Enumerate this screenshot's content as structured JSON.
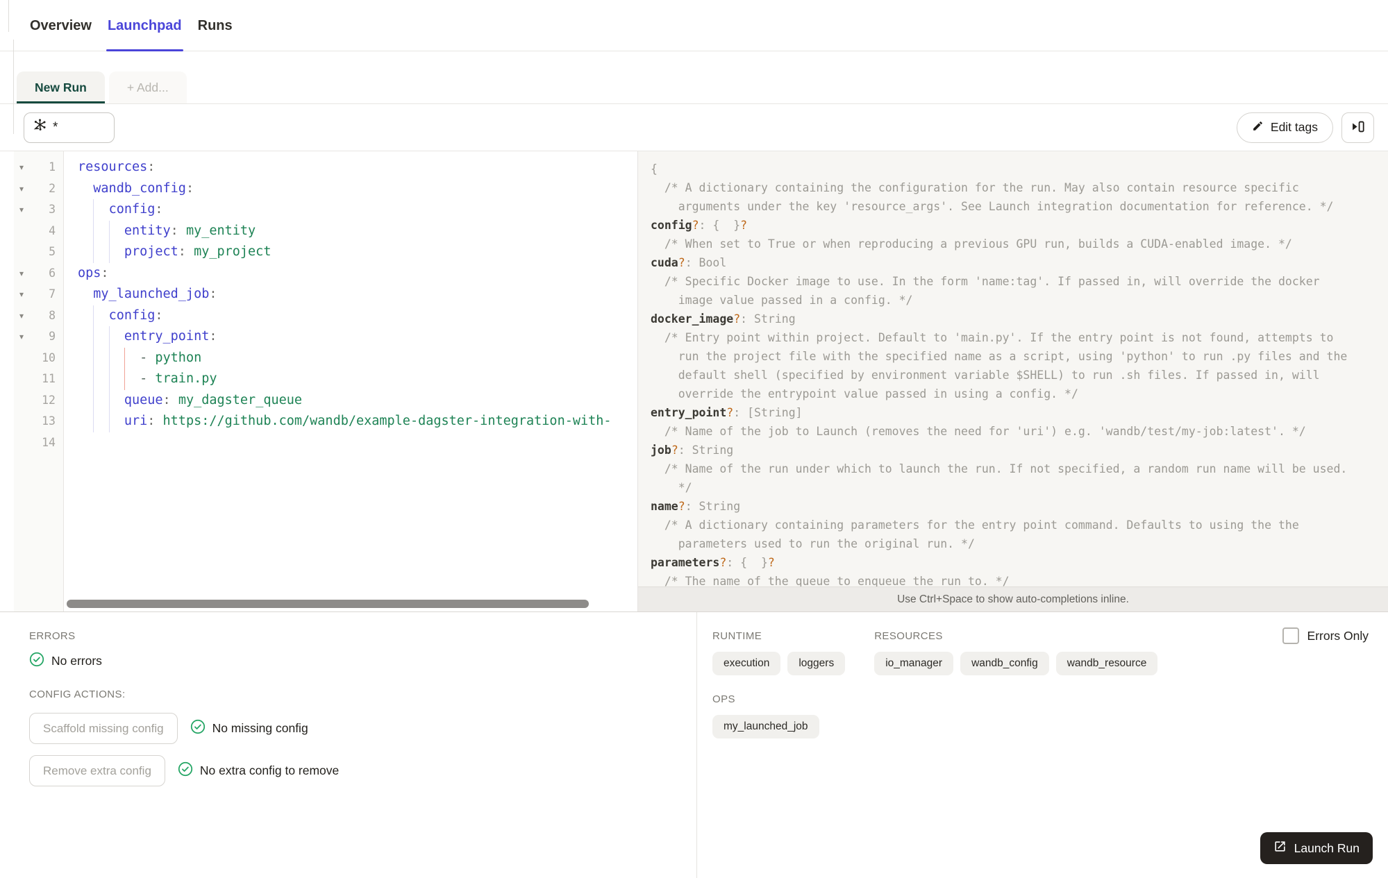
{
  "header": {
    "tabs": [
      {
        "label": "Overview",
        "active": false
      },
      {
        "label": "Launchpad",
        "active": true
      },
      {
        "label": "Runs",
        "active": false
      }
    ]
  },
  "session": {
    "tabs": [
      {
        "label": "New Run",
        "active": true
      },
      {
        "label": "+ Add...",
        "active": false
      }
    ]
  },
  "toolbar": {
    "op_selector_value": "*",
    "op_selector_icon": "op-selector-icon",
    "edit_tags": "Edit tags",
    "expand_icon": "open-in-panel-icon"
  },
  "editor": {
    "yaml_lines": [
      {
        "n": "1",
        "fold": true,
        "guides": [],
        "tokens": [
          [
            "k",
            "resources"
          ],
          [
            "p",
            ":"
          ]
        ]
      },
      {
        "n": "2",
        "fold": true,
        "guides": [],
        "tokens": [
          [
            "w",
            "  "
          ],
          [
            "k",
            "wandb_config"
          ],
          [
            "p",
            ":"
          ]
        ]
      },
      {
        "n": "3",
        "fold": true,
        "guides": [
          2
        ],
        "tokens": [
          [
            "w",
            "    "
          ],
          [
            "k",
            "config"
          ],
          [
            "p",
            ":"
          ]
        ]
      },
      {
        "n": "4",
        "fold": false,
        "guides": [
          2,
          4
        ],
        "tokens": [
          [
            "w",
            "      "
          ],
          [
            "k",
            "entity"
          ],
          [
            "p",
            ":"
          ],
          [
            "w",
            " "
          ],
          [
            "v",
            "my_entity"
          ]
        ]
      },
      {
        "n": "5",
        "fold": false,
        "guides": [
          2,
          4
        ],
        "tokens": [
          [
            "w",
            "      "
          ],
          [
            "k",
            "project"
          ],
          [
            "p",
            ":"
          ],
          [
            "w",
            " "
          ],
          [
            "v",
            "my_project"
          ]
        ]
      },
      {
        "n": "6",
        "fold": true,
        "guides": [],
        "tokens": [
          [
            "k",
            "ops"
          ],
          [
            "p",
            ":"
          ]
        ]
      },
      {
        "n": "7",
        "fold": true,
        "guides": [],
        "tokens": [
          [
            "w",
            "  "
          ],
          [
            "k",
            "my_launched_job"
          ],
          [
            "p",
            ":"
          ]
        ]
      },
      {
        "n": "8",
        "fold": true,
        "guides": [
          2
        ],
        "tokens": [
          [
            "w",
            "    "
          ],
          [
            "k",
            "config"
          ],
          [
            "p",
            ":"
          ]
        ]
      },
      {
        "n": "9",
        "fold": true,
        "guides": [
          2,
          4
        ],
        "tokens": [
          [
            "w",
            "      "
          ],
          [
            "k",
            "entry_point"
          ],
          [
            "p",
            ":"
          ]
        ]
      },
      {
        "n": "10",
        "fold": false,
        "guides": [
          2,
          4
        ],
        "active_guide": 6,
        "tokens": [
          [
            "w",
            "        "
          ],
          [
            "d",
            "-"
          ],
          [
            "w",
            " "
          ],
          [
            "v",
            "python"
          ]
        ]
      },
      {
        "n": "11",
        "fold": false,
        "guides": [
          2,
          4
        ],
        "active_guide": 6,
        "tokens": [
          [
            "w",
            "        "
          ],
          [
            "d",
            "-"
          ],
          [
            "w",
            " "
          ],
          [
            "v",
            "train.py"
          ]
        ]
      },
      {
        "n": "12",
        "fold": false,
        "guides": [
          2,
          4
        ],
        "tokens": [
          [
            "w",
            "      "
          ],
          [
            "k",
            "queue"
          ],
          [
            "p",
            ":"
          ],
          [
            "w",
            " "
          ],
          [
            "v",
            "my_dagster_queue"
          ]
        ]
      },
      {
        "n": "13",
        "fold": false,
        "guides": [
          2,
          4
        ],
        "tokens": [
          [
            "w",
            "      "
          ],
          [
            "k",
            "uri"
          ],
          [
            "p",
            ":"
          ],
          [
            "w",
            " "
          ],
          [
            "v",
            "https://github.com/wandb/example-dagster-integration-with-"
          ]
        ]
      },
      {
        "n": "14",
        "fold": false,
        "guides": [],
        "tokens": []
      }
    ],
    "schema_lines": [
      [
        [
          "g",
          "{"
        ]
      ],
      [
        [
          "g",
          "  /* A dictionary containing the configuration for the run. May also contain resource specific"
        ]
      ],
      [
        [
          "g",
          "    arguments under the key 'resource_args'. See Launch integration documentation for reference. */"
        ]
      ],
      [
        [
          "key",
          "config"
        ],
        [
          "q",
          "?"
        ],
        [
          "g",
          ": {  }"
        ],
        [
          "q",
          "?"
        ]
      ],
      [
        [
          "g",
          "  /* When set to True or when reproducing a previous GPU run, builds a CUDA-enabled image. */"
        ]
      ],
      [
        [
          "key",
          "cuda"
        ],
        [
          "q",
          "?"
        ],
        [
          "g",
          ": Bool"
        ]
      ],
      [
        [
          "g",
          "  /* Specific Docker image to use. In the form 'name:tag'. If passed in, will override the docker"
        ]
      ],
      [
        [
          "g",
          "    image value passed in a config. */"
        ]
      ],
      [
        [
          "key",
          "docker_image"
        ],
        [
          "q",
          "?"
        ],
        [
          "g",
          ": String"
        ]
      ],
      [
        [
          "g",
          "  /* Entry point within project. Default to 'main.py'. If the entry point is not found, attempts to"
        ]
      ],
      [
        [
          "g",
          "    run the project file with the specified name as a script, using 'python' to run .py files and the"
        ]
      ],
      [
        [
          "g",
          "    default shell (specified by environment variable $SHELL) to run .sh files. If passed in, will"
        ]
      ],
      [
        [
          "g",
          "    override the entrypoint value passed in using a config. */"
        ]
      ],
      [
        [
          "key",
          "entry_point"
        ],
        [
          "q",
          "?"
        ],
        [
          "g",
          ": [String]"
        ]
      ],
      [
        [
          "g",
          "  /* Name of the job to Launch (removes the need for 'uri') e.g. 'wandb/test/my-job:latest'. */"
        ]
      ],
      [
        [
          "key",
          "job"
        ],
        [
          "q",
          "?"
        ],
        [
          "g",
          ": String"
        ]
      ],
      [
        [
          "g",
          "  /* Name of the run under which to launch the run. If not specified, a random run name will be used."
        ]
      ],
      [
        [
          "g",
          "    */"
        ]
      ],
      [
        [
          "key",
          "name"
        ],
        [
          "q",
          "?"
        ],
        [
          "g",
          ": String"
        ]
      ],
      [
        [
          "g",
          "  /* A dictionary containing parameters for the entry point command. Defaults to using the the"
        ]
      ],
      [
        [
          "g",
          "    parameters used to run the original run. */"
        ]
      ],
      [
        [
          "key",
          "parameters"
        ],
        [
          "q",
          "?"
        ],
        [
          "g",
          ": {  }"
        ],
        [
          "q",
          "?"
        ]
      ],
      [
        [
          "g",
          "  /* The name of the queue to enqueue the run to. */"
        ]
      ]
    ],
    "hint": "Use Ctrl+Space to show auto-completions inline."
  },
  "panels": {
    "errors": {
      "label": "ERRORS",
      "status": "No errors"
    },
    "config_actions": {
      "label": "CONFIG ACTIONS:",
      "actions": [
        {
          "button": "Scaffold missing config",
          "status": "No missing config"
        },
        {
          "button": "Remove extra config",
          "status": "No extra config to remove"
        }
      ]
    },
    "runtime": {
      "label": "RUNTIME",
      "tags": [
        "execution",
        "loggers"
      ]
    },
    "resources": {
      "label": "RESOURCES",
      "tags": [
        "io_manager",
        "wandb_config",
        "wandb_resource"
      ]
    },
    "ops": {
      "label": "OPS",
      "tags": [
        "my_launched_job"
      ]
    },
    "errors_only": {
      "label": "Errors Only",
      "checked": false
    },
    "launch": {
      "label": "Launch Run"
    }
  },
  "colors": {
    "accent_indigo": "#4a45d9",
    "accent_green_dark": "#164a3f",
    "code_key": "#4040cc",
    "code_value": "#1e8355",
    "schema_optional": "#bf6a1c",
    "success_green": "#23a564",
    "launch_bg": "#25211e"
  }
}
